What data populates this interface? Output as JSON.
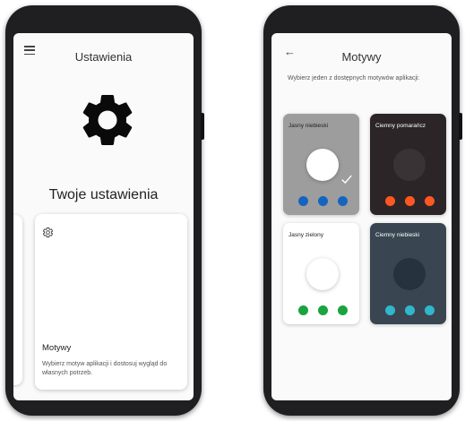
{
  "settings_screen": {
    "appbar": {
      "title": "Ustawienia",
      "menu_icon": "hamburger-menu-icon"
    },
    "hero": {
      "icon": "gear-icon",
      "title": "Twoje ustawienia"
    },
    "cards": [
      {
        "icon": "gear-outline-icon",
        "title": "Motywy",
        "description": "Wybierz motyw aplikacji i dostosuj wygląd do własnych potrzeb."
      }
    ]
  },
  "themes_screen": {
    "appbar": {
      "title": "Motywy",
      "back_icon": "back-arrow-icon"
    },
    "intro": "Wybierz jeden z dostępnych motywów aplikacji:",
    "themes": [
      {
        "name": "Jasny niebieski",
        "selected": true,
        "background": "#9d9d9d",
        "name_color": "#222222",
        "circle_color": "#ffffff",
        "dot_color": "#1565c0"
      },
      {
        "name": "Ciemny pomarańcz",
        "selected": false,
        "background": "#2b2527",
        "name_color": "#ffffff",
        "circle_color": "#3a3335",
        "dot_color": "#ff5722"
      },
      {
        "name": "Jasny zielony",
        "selected": false,
        "background": "#ffffff",
        "name_color": "#222222",
        "circle_color": "#ffffff",
        "dot_color": "#1aa33f"
      },
      {
        "name": "Ciemny niebieski",
        "selected": false,
        "background": "#394651",
        "name_color": "#ffffff",
        "circle_color": "#26323d",
        "dot_color": "#2fb7cc"
      }
    ]
  },
  "colors": {
    "phone_frame": "#1f1f22",
    "screen_background": "#fafafa"
  }
}
